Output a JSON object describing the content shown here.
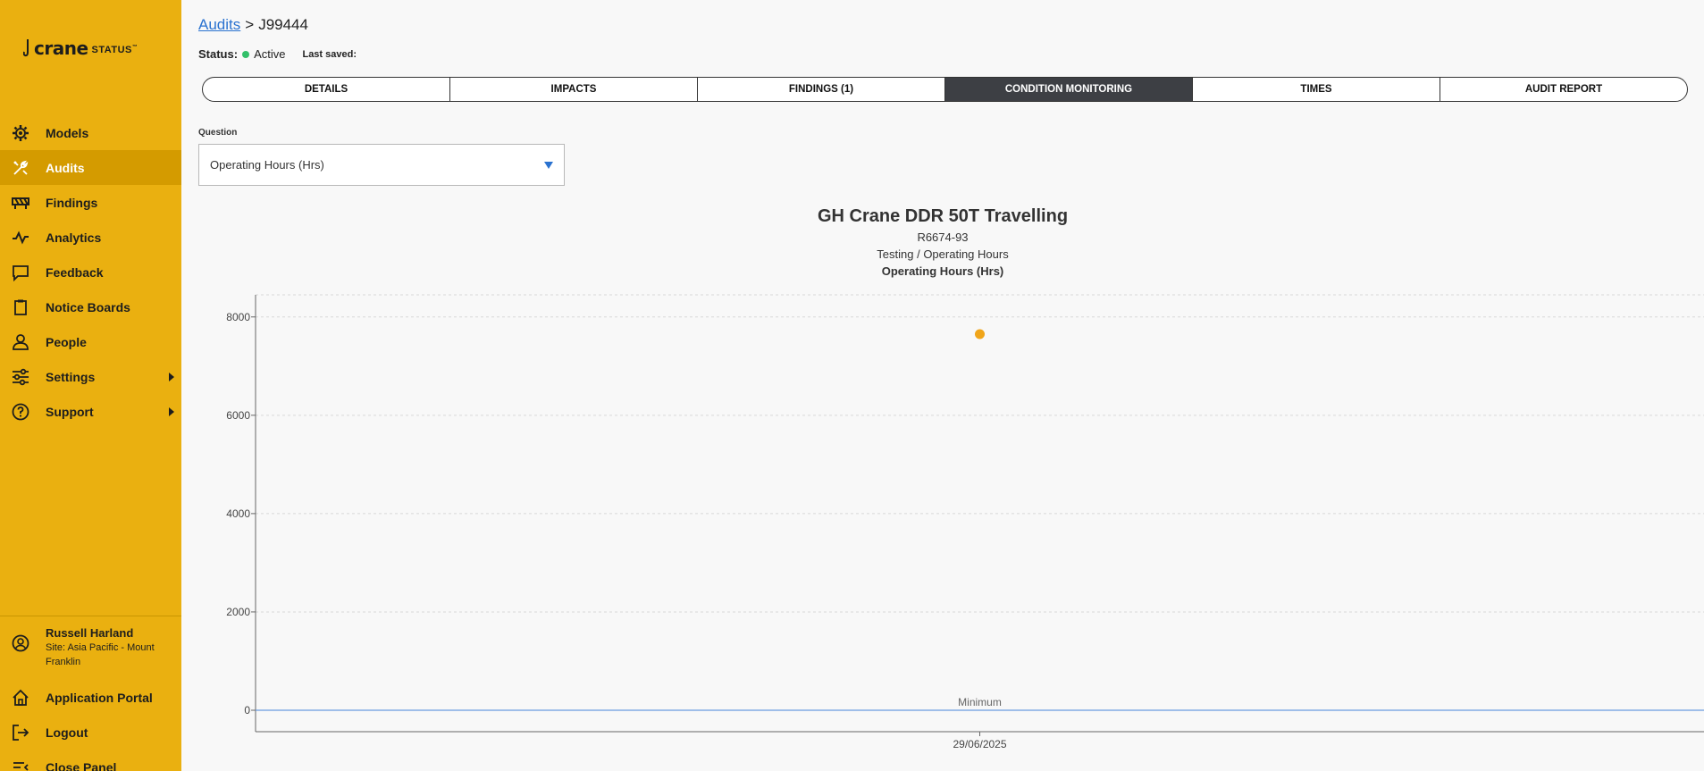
{
  "sidebar": {
    "logo": {
      "brand": "crane",
      "suffix": "STATUS",
      "tm": "™"
    },
    "items": [
      {
        "label": "Models",
        "icon": "gear-icon"
      },
      {
        "label": "Audits",
        "icon": "tools-icon"
      },
      {
        "label": "Findings",
        "icon": "barrier-icon"
      },
      {
        "label": "Analytics",
        "icon": "pulse-icon"
      },
      {
        "label": "Feedback",
        "icon": "chat-icon"
      },
      {
        "label": "Notice Boards",
        "icon": "clipboard-icon"
      },
      {
        "label": "People",
        "icon": "person-icon"
      },
      {
        "label": "Settings",
        "icon": "sliders-icon"
      },
      {
        "label": "Support",
        "icon": "help-icon"
      }
    ],
    "user": {
      "name": "Russell Harland",
      "site": "Site: Asia Pacific - Mount Franklin"
    },
    "bottom": [
      {
        "label": "Application Portal",
        "icon": "home-icon"
      },
      {
        "label": "Logout",
        "icon": "logout-icon"
      },
      {
        "label": "Close Panel",
        "icon": "collapse-icon"
      }
    ]
  },
  "breadcrumb": {
    "link": "Audits",
    "separator": ">",
    "current": "J99444"
  },
  "status": {
    "label": "Status:",
    "value": "Active",
    "last_saved_label": "Last saved:"
  },
  "tabs": [
    "DETAILS",
    "IMPACTS",
    "FINDINGS (1)",
    "CONDITION MONITORING",
    "TIMES",
    "AUDIT REPORT"
  ],
  "question": {
    "label": "Question",
    "value": "Operating Hours (Hrs)"
  },
  "chart_head": {
    "title": "GH Crane DDR 50T Travelling",
    "subtitle": "R6674-93",
    "subtitle2": "Testing / Operating Hours",
    "measure": "Operating Hours (Hrs)"
  },
  "colors": {
    "accent": "#eab010",
    "active_nav": "#d49b00",
    "link": "#2a72d0",
    "point": "#f0a51a",
    "minimum_line": "#6a9be0",
    "status_active": "#33c06a"
  },
  "chart_data": {
    "type": "scatter",
    "x": [
      "29/06/2025"
    ],
    "series": [
      {
        "values": [
          7650
        ]
      }
    ],
    "yticks": [
      0,
      2000,
      4000,
      6000,
      8000
    ],
    "ylim": [
      0,
      8450
    ],
    "grid": true,
    "reference_lines": [
      {
        "label": "Minimum",
        "value": 0
      }
    ]
  }
}
